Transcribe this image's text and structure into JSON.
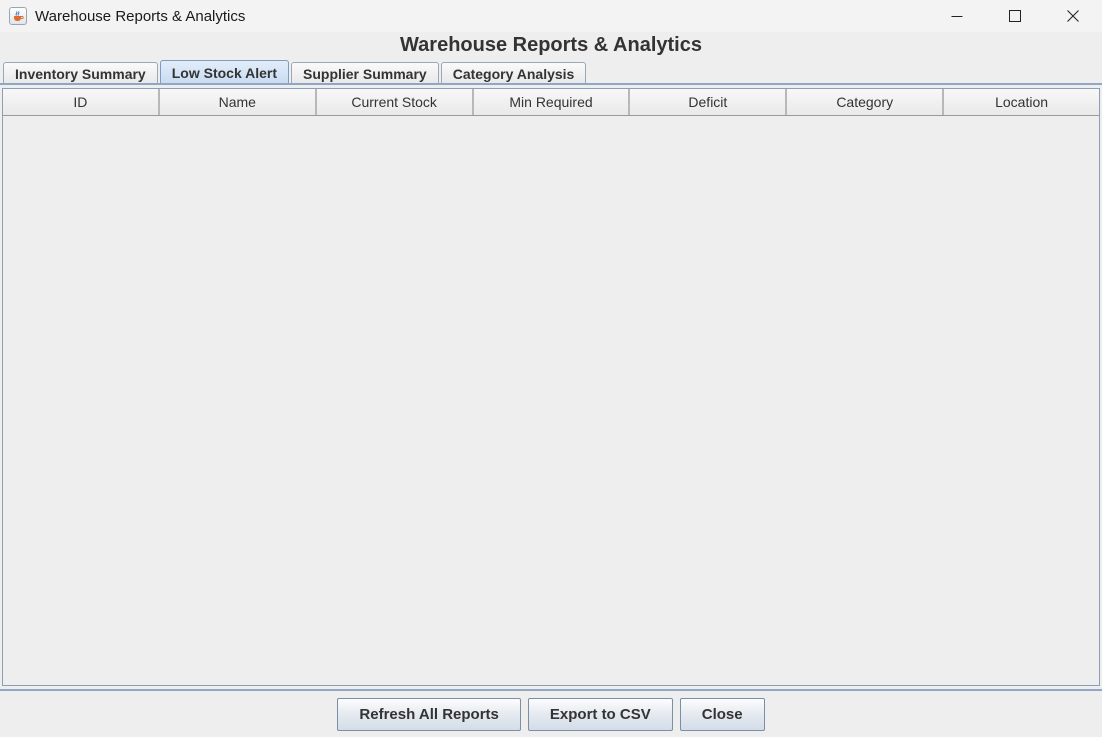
{
  "window": {
    "title": "Warehouse Reports & Analytics",
    "icon": "java-cup-icon"
  },
  "heading": "Warehouse Reports & Analytics",
  "tabs": [
    {
      "label": "Inventory Summary",
      "selected": false
    },
    {
      "label": "Low Stock Alert",
      "selected": true
    },
    {
      "label": "Supplier Summary",
      "selected": false
    },
    {
      "label": "Category Analysis",
      "selected": false
    }
  ],
  "table": {
    "columns": [
      "ID",
      "Name",
      "Current Stock",
      "Min Required",
      "Deficit",
      "Category",
      "Location"
    ],
    "rows": []
  },
  "buttons": {
    "refresh": "Refresh All Reports",
    "export": "Export to CSV",
    "close": "Close"
  },
  "colors": {
    "selected_tab": "#c8dbf2",
    "accent_border": "#8fa7c4",
    "background": "#eeeeee"
  }
}
